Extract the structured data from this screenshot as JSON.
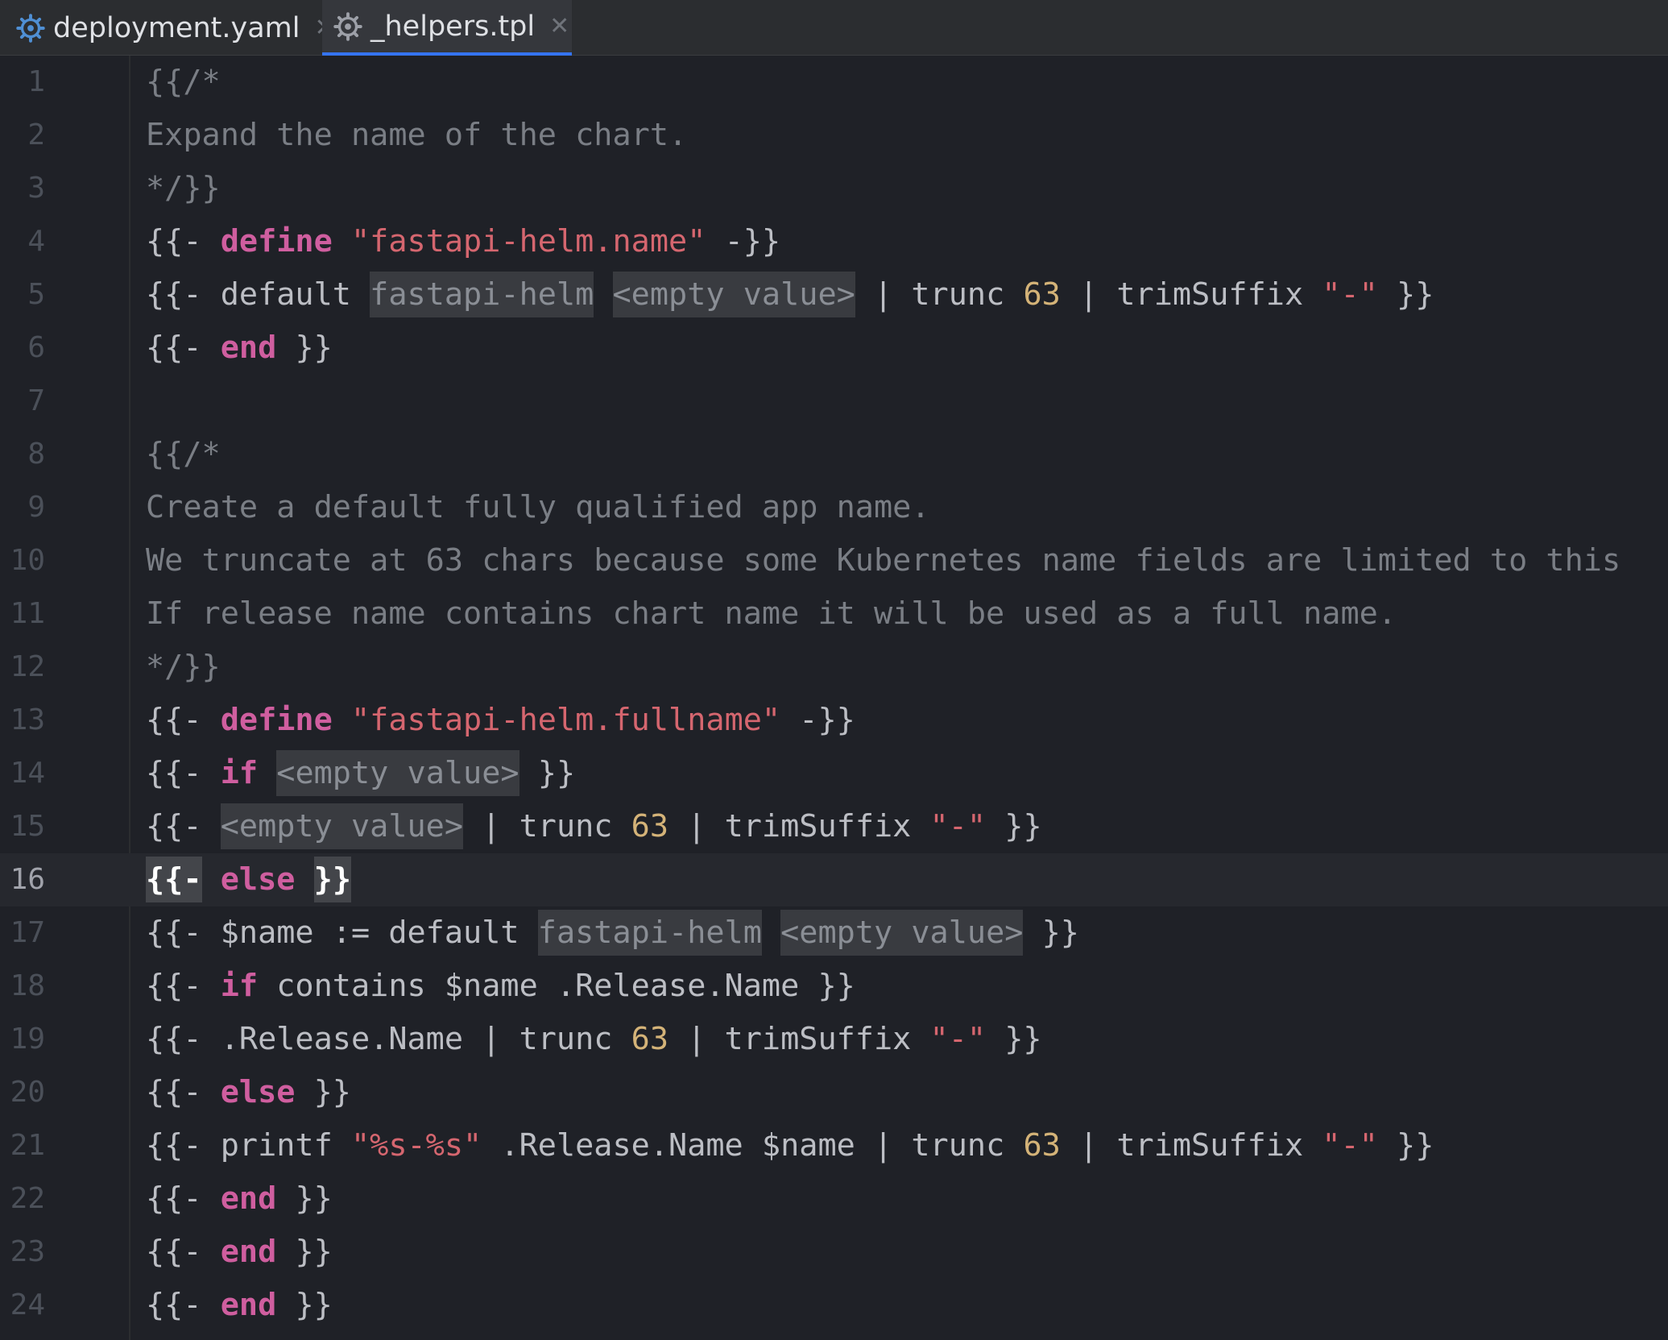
{
  "tabs": [
    {
      "label": "deployment.yaml",
      "icon": "gear-icon",
      "icon_color": "#4f8fd4",
      "active": false
    },
    {
      "label": "_helpers.tpl",
      "icon": "gear-icon",
      "icon_color": "#9da0a8",
      "active": true
    }
  ],
  "current_line": 16,
  "colors": {
    "keyword": "#cf5e9f",
    "string": "#d5666f",
    "number": "#d4b378",
    "comment": "#7a7e85",
    "text": "#bcbec4",
    "placeholder_bg": "#393b40",
    "accent": "#3574f0"
  },
  "lines": [
    {
      "n": "1",
      "tokens": [
        [
          "cm",
          "{{/*"
        ]
      ]
    },
    {
      "n": "2",
      "tokens": [
        [
          "cm",
          "Expand the name of the chart."
        ]
      ]
    },
    {
      "n": "3",
      "tokens": [
        [
          "cm",
          "*/}}"
        ]
      ]
    },
    {
      "n": "4",
      "tokens": [
        [
          "t",
          "{{- "
        ],
        [
          "kw",
          "define"
        ],
        [
          "t",
          " "
        ],
        [
          "st",
          "\"fastapi-helm.name\""
        ],
        [
          "t",
          " -}}"
        ]
      ]
    },
    {
      "n": "5",
      "tokens": [
        [
          "t",
          "{{- default "
        ],
        [
          "ph",
          "fastapi-helm"
        ],
        [
          "t",
          " "
        ],
        [
          "ph",
          "<empty value>"
        ],
        [
          "t",
          " | trunc "
        ],
        [
          "nm",
          "63"
        ],
        [
          "t",
          " | trimSuffix "
        ],
        [
          "st",
          "\"-\""
        ],
        [
          "t",
          " }}"
        ]
      ]
    },
    {
      "n": "6",
      "tokens": [
        [
          "t",
          "{{- "
        ],
        [
          "kw",
          "end"
        ],
        [
          "t",
          " }}"
        ]
      ]
    },
    {
      "n": "7",
      "tokens": []
    },
    {
      "n": "8",
      "tokens": [
        [
          "cm",
          "{{/*"
        ]
      ]
    },
    {
      "n": "9",
      "tokens": [
        [
          "cm",
          "Create a default fully qualified app name."
        ]
      ]
    },
    {
      "n": "10",
      "tokens": [
        [
          "cm",
          "We truncate at 63 chars because some Kubernetes name fields are limited to this"
        ]
      ]
    },
    {
      "n": "11",
      "tokens": [
        [
          "cm",
          "If release name contains chart name it will be used as a full name."
        ]
      ]
    },
    {
      "n": "12",
      "tokens": [
        [
          "cm",
          "*/}}"
        ]
      ]
    },
    {
      "n": "13",
      "tokens": [
        [
          "t",
          "{{- "
        ],
        [
          "kw",
          "define"
        ],
        [
          "t",
          " "
        ],
        [
          "st",
          "\"fastapi-helm.fullname\""
        ],
        [
          "t",
          " -}}"
        ]
      ]
    },
    {
      "n": "14",
      "tokens": [
        [
          "t",
          "{{- "
        ],
        [
          "kw",
          "if"
        ],
        [
          "t",
          " "
        ],
        [
          "ph",
          "<empty value>"
        ],
        [
          "t",
          " }}"
        ]
      ]
    },
    {
      "n": "15",
      "tokens": [
        [
          "t",
          "{{- "
        ],
        [
          "ph",
          "<empty value>"
        ],
        [
          "t",
          " | trunc "
        ],
        [
          "nm",
          "63"
        ],
        [
          "t",
          " | trimSuffix "
        ],
        [
          "st",
          "\"-\""
        ],
        [
          "t",
          " }}"
        ]
      ]
    },
    {
      "n": "16",
      "tokens": [
        [
          "br",
          "{{-"
        ],
        [
          "t",
          " "
        ],
        [
          "kw",
          "else"
        ],
        [
          "t",
          " "
        ],
        [
          "br",
          "}}"
        ]
      ]
    },
    {
      "n": "17",
      "tokens": [
        [
          "t",
          "{{- $name := default "
        ],
        [
          "ph",
          "fastapi-helm"
        ],
        [
          "t",
          " "
        ],
        [
          "ph",
          "<empty value>"
        ],
        [
          "t",
          " }}"
        ]
      ]
    },
    {
      "n": "18",
      "tokens": [
        [
          "t",
          "{{- "
        ],
        [
          "kw",
          "if"
        ],
        [
          "t",
          " contains $name .Release.Name }}"
        ]
      ]
    },
    {
      "n": "19",
      "tokens": [
        [
          "t",
          "{{- .Release.Name | trunc "
        ],
        [
          "nm",
          "63"
        ],
        [
          "t",
          " | trimSuffix "
        ],
        [
          "st",
          "\"-\""
        ],
        [
          "t",
          " }}"
        ]
      ]
    },
    {
      "n": "20",
      "tokens": [
        [
          "t",
          "{{- "
        ],
        [
          "kw",
          "else"
        ],
        [
          "t",
          " }}"
        ]
      ]
    },
    {
      "n": "21",
      "tokens": [
        [
          "t",
          "{{- printf "
        ],
        [
          "st",
          "\"%s-%s\""
        ],
        [
          "t",
          " .Release.Name $name | trunc "
        ],
        [
          "nm",
          "63"
        ],
        [
          "t",
          " | trimSuffix "
        ],
        [
          "st",
          "\"-\""
        ],
        [
          "t",
          " }}"
        ]
      ]
    },
    {
      "n": "22",
      "tokens": [
        [
          "t",
          "{{- "
        ],
        [
          "kw",
          "end"
        ],
        [
          "t",
          " }}"
        ]
      ]
    },
    {
      "n": "23",
      "tokens": [
        [
          "t",
          "{{- "
        ],
        [
          "kw",
          "end"
        ],
        [
          "t",
          " }}"
        ]
      ]
    },
    {
      "n": "24",
      "tokens": [
        [
          "t",
          "{{- "
        ],
        [
          "kw",
          "end"
        ],
        [
          "t",
          " }}"
        ]
      ]
    }
  ]
}
